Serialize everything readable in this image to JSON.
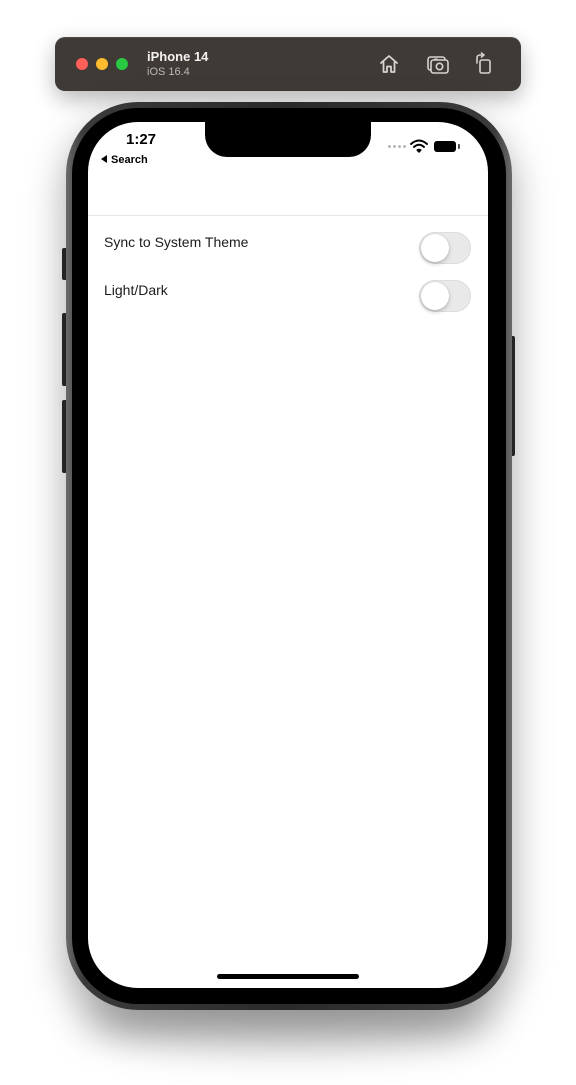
{
  "simulator": {
    "device_name": "iPhone 14",
    "os_version": "iOS 16.4",
    "toolbar": [
      {
        "icon": "home-icon"
      },
      {
        "icon": "screenshot-icon"
      },
      {
        "icon": "rotate-icon"
      }
    ]
  },
  "status_bar": {
    "time": "1:27",
    "back_label": "Search",
    "icons": [
      "cellular-signal-icon",
      "wifi-icon",
      "battery-icon"
    ]
  },
  "settings": {
    "items": [
      {
        "label": "Sync to System Theme",
        "enabled": false
      },
      {
        "label": "Light/Dark",
        "enabled": false
      }
    ]
  },
  "colors": {
    "toggle_off_track": "#e9e9ea",
    "window_bar": "#3f3a36",
    "traffic_red": "#fe5f57",
    "traffic_yellow": "#febc2e",
    "traffic_green": "#28c840"
  }
}
